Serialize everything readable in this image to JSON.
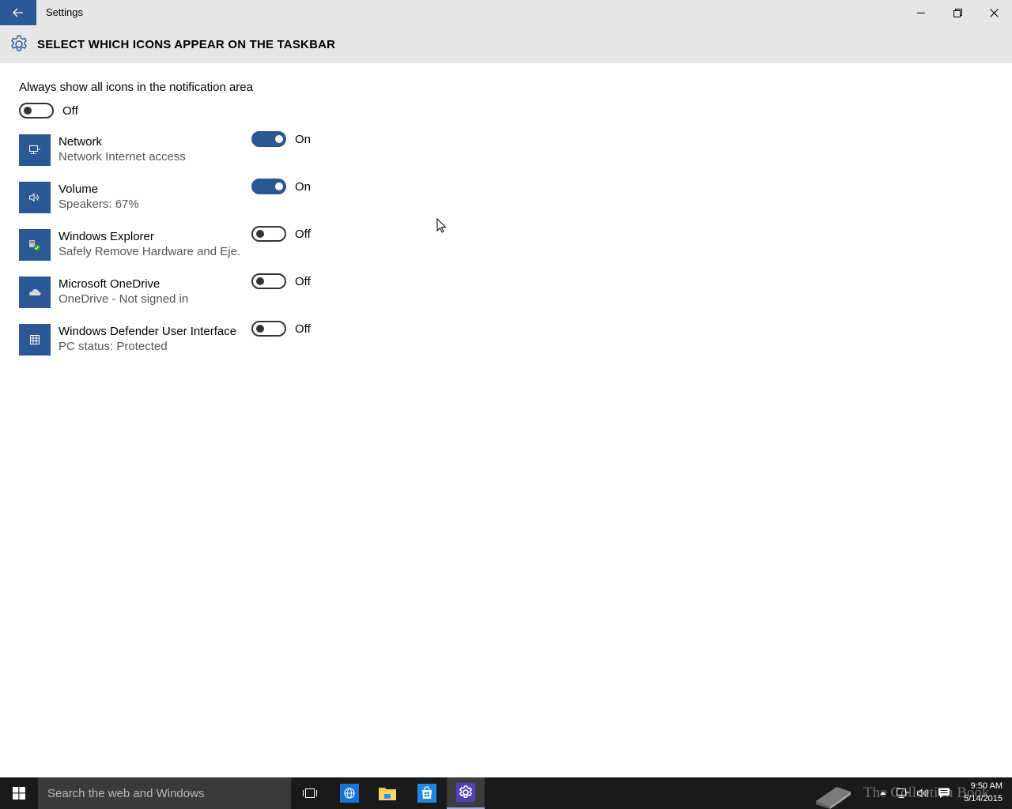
{
  "window": {
    "title": "Settings"
  },
  "header": {
    "title": "SELECT WHICH ICONS APPEAR ON THE TASKBAR"
  },
  "always_show": {
    "label": "Always show all icons in the notification area",
    "state": "Off",
    "on": false
  },
  "items": [
    {
      "name": "Network",
      "subtitle": "Network Internet access",
      "state": "On",
      "on": true,
      "icon": "network-icon"
    },
    {
      "name": "Volume",
      "subtitle": "Speakers: 67%",
      "state": "On",
      "on": true,
      "icon": "volume-icon"
    },
    {
      "name": "Windows Explorer",
      "subtitle": "Safely Remove Hardware and Eje...",
      "state": "Off",
      "on": false,
      "icon": "safely-remove-hardware-icon"
    },
    {
      "name": "Microsoft OneDrive",
      "subtitle": "OneDrive - Not signed in",
      "state": "Off",
      "on": false,
      "icon": "onedrive-icon"
    },
    {
      "name": "Windows Defender User Interface",
      "subtitle": "PC status: Protected",
      "state": "Off",
      "on": false,
      "icon": "windows-defender-icon"
    }
  ],
  "taskbar": {
    "search_placeholder": "Search the web and Windows",
    "clock_time": "9:50 AM",
    "clock_date": "5/14/2015",
    "watermark": "The Collection Book"
  },
  "colors": {
    "accent": "#2b5797",
    "titlebar": "#e6e6e6",
    "taskbar": "#1a1a1a"
  }
}
